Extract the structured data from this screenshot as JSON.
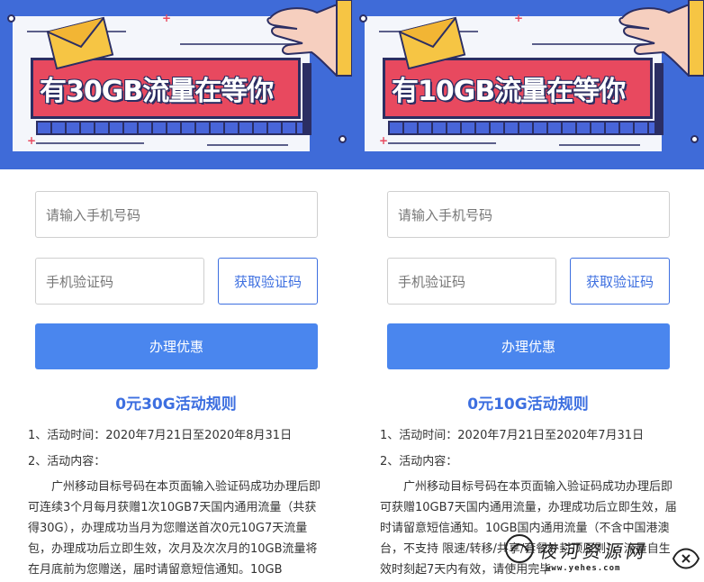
{
  "panels": [
    {
      "headline": "有30GB流量在等你",
      "phone_placeholder": "请输入手机号码",
      "code_placeholder": "手机验证码",
      "get_code_label": "获取验证码",
      "submit_label": "办理优惠",
      "rules_title": "0元30G活动规则",
      "rule_time": "1、活动时间：2020年7月21日至2020年8月31日",
      "rule_content_label": "2、活动内容：",
      "rule_text": "广州移动目标号码在本页面输入验证码成功办理后即可连续3个月每月获赠1次10GB7天国内通用流量（共获得30G），办理成功当月为您赠送首次0元10G7天流量包，办理成功后立即生效，次月及次次月的10GB流量将在月底前为您赠送，届时请留意短信通知。10GB"
    },
    {
      "headline": "有10GB流量在等你",
      "phone_placeholder": "请输入手机号码",
      "code_placeholder": "手机验证码",
      "get_code_label": "获取验证码",
      "submit_label": "办理优惠",
      "rules_title": "0元10G活动规则",
      "rule_time": "1、活动时间：2020年7月21日至2020年7月31日",
      "rule_content_label": "2、活动内容：",
      "rule_text": "广州移动目标号码在本页面输入验证码成功办理后即可获赠10GB7天国内通用流量，办理成功后立即生效，届时请留意短信通知。10GB国内通用流量（不含中国港澳台，不支持 限速/转移/共享/套餐外封顶原则），流量自生效时刻起7天内有效，请使用完毕"
    }
  ],
  "watermark": {
    "text": "夜河资源网",
    "url": "www.yehes.com"
  },
  "colors": {
    "banner_bg": "#3f6bd8",
    "card_red": "#e8495f",
    "accent_blue": "#3d6fe0",
    "submit_blue": "#4a86ee",
    "envelope_yellow": "#f6c544"
  }
}
